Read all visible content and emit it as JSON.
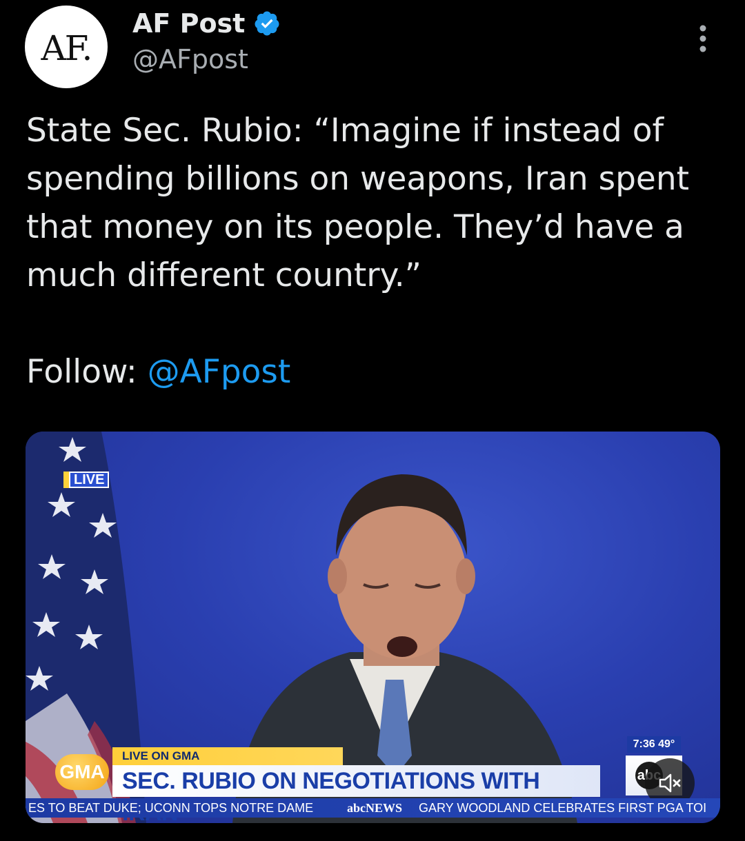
{
  "author": {
    "avatar_text": "AF.",
    "display_name": "AF Post",
    "handle": "@AFpost",
    "verified": true
  },
  "tweet": {
    "text": "State Sec. Rubio: “Imagine if instead of spending billions on weapons, Iran spent that money on its people. They’d have a much different country.”",
    "follow_label": "Follow:",
    "follow_handle": "@AFpost"
  },
  "video": {
    "live_badge": "LIVE",
    "chyron_top": "LIVE ON GMA",
    "chyron_headline": "SEC. RUBIO ON NEGOTIATIONS WITH IRAN",
    "network_logo": "GMA",
    "clock": "7:36  49°",
    "abc_logo": "abc",
    "ticker_left": "ES TO BEAT DUKE;  UCONN TOPS NOTRE DAME",
    "ticker_brand": "abcNEWS",
    "ticker_right": "GARY WOODLAND CELEBRATES FIRST PGA TOI",
    "muted": true
  },
  "colors": {
    "background": "#000000",
    "text": "#e7e9ea",
    "secondary_text": "#a9aeb3",
    "link": "#1d9bf0",
    "verified_badge": "#1d9bf0"
  },
  "icons": [
    "verified-badge-icon",
    "more-options-icon",
    "mute-icon"
  ]
}
